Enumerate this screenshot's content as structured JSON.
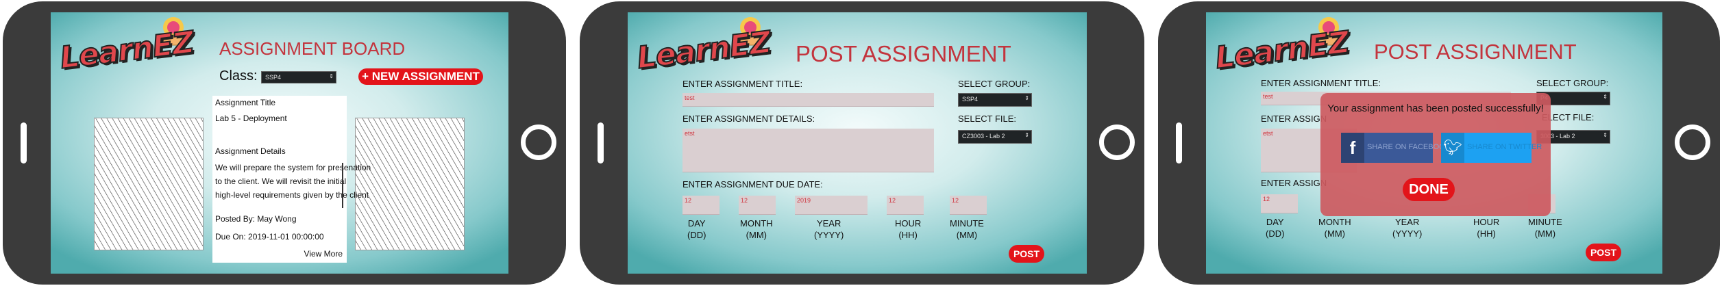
{
  "brand": {
    "logo_text": "LearnEZ"
  },
  "board": {
    "title": "ASSIGNMENT BOARD",
    "class_label": "Class:",
    "class_value": "SSP4",
    "new_button": "+ NEW ASSIGNMENT",
    "card": {
      "title_heading": "Assignment Title",
      "title_value": "Lab 5 - Deployment",
      "details_heading": "Assignment Details",
      "details_line1": "We will prepare the system for presenation",
      "details_line2": "to the client. We will revisit the initial",
      "details_line3": "high-level requirements given by the client",
      "posted_by": "Posted By: May Wong",
      "due_on": "Due On: 2019-11-01 00:00:00",
      "view_more": "View More"
    }
  },
  "post": {
    "title": "POST ASSIGNMENT",
    "title_label": "ENTER ASSIGNMENT TITLE:",
    "title_value": "test",
    "details_label": "ENTER ASSIGNMENT DETAILS:",
    "details_value": "etst",
    "group_label": "SELECT GROUP:",
    "group_value": "SSP4",
    "file_label": "SELECT FILE:",
    "file_value": "CZ3003 - Lab 2",
    "due_label": "ENTER ASSIGNMENT DUE DATE:",
    "day": "12",
    "month": "12",
    "year": "2019",
    "hour": "12",
    "minute": "12",
    "day_label": "DAY",
    "day_fmt": "(DD)",
    "month_label": "MONTH",
    "month_fmt": "(MM)",
    "year_label": "YEAR",
    "year_fmt": "(YYYY)",
    "hour_label": "HOUR",
    "hour_fmt": "(HH)",
    "minute_label": "MINUTE",
    "minute_fmt": "(MM)",
    "post_button": "POST"
  },
  "success": {
    "title_label": "ENTER ASSIGNMENT TITLE:",
    "details_label_partial": "ENTER ASSIGN",
    "due_label_partial": "ENTER ASSIGN",
    "file_value_partial": "3003 - Lab 2",
    "group_value_partial": "P4",
    "group_label_partial": "SELECT GROUP:",
    "file_label_partial": "ELECT FILE:",
    "message": "Your assignment has been posted successfully!",
    "facebook_label": "SHARE ON FACEBOOK",
    "twitter_label": "SHARE ON TWITTER",
    "done_button": "DONE"
  },
  "colors": {
    "accent": "#c3343d",
    "button": "#e3141a",
    "facebook": "#3b5998",
    "twitter": "#1da1f2"
  }
}
